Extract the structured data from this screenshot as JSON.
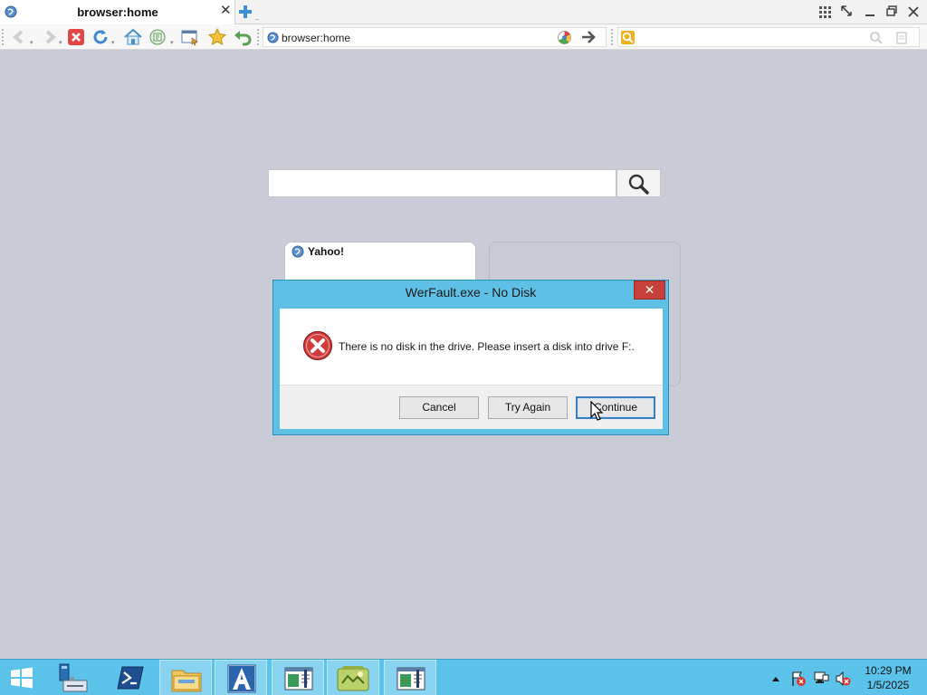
{
  "browser": {
    "tab_title": "browser:home",
    "address": "browser:home"
  },
  "home": {
    "search_value": "",
    "speed_dial": [
      {
        "label": "Yahoo!"
      },
      {
        "label": ""
      }
    ]
  },
  "dialog": {
    "title": "WerFault.exe - No Disk",
    "close_label": "✕",
    "message": "There is no disk in the drive. Please insert a disk into drive F:.",
    "buttons": {
      "cancel": "Cancel",
      "try_again": "Try Again",
      "continue": "Continue"
    }
  },
  "taskbar": {
    "time": "10:29 PM",
    "date": "1/5/2025",
    "items": [
      "start-icon",
      "server-manager-icon",
      "powershell-icon",
      "file-explorer-icon",
      "browser-app-icon",
      "window-app-icon",
      "game-app-icon",
      "window-app-icon"
    ]
  },
  "colors": {
    "dialog_frame": "#5fc0e6",
    "dialog_close": "#c7403a",
    "taskbar": "#5bc3ea",
    "page_background": "#c9ccd6"
  }
}
